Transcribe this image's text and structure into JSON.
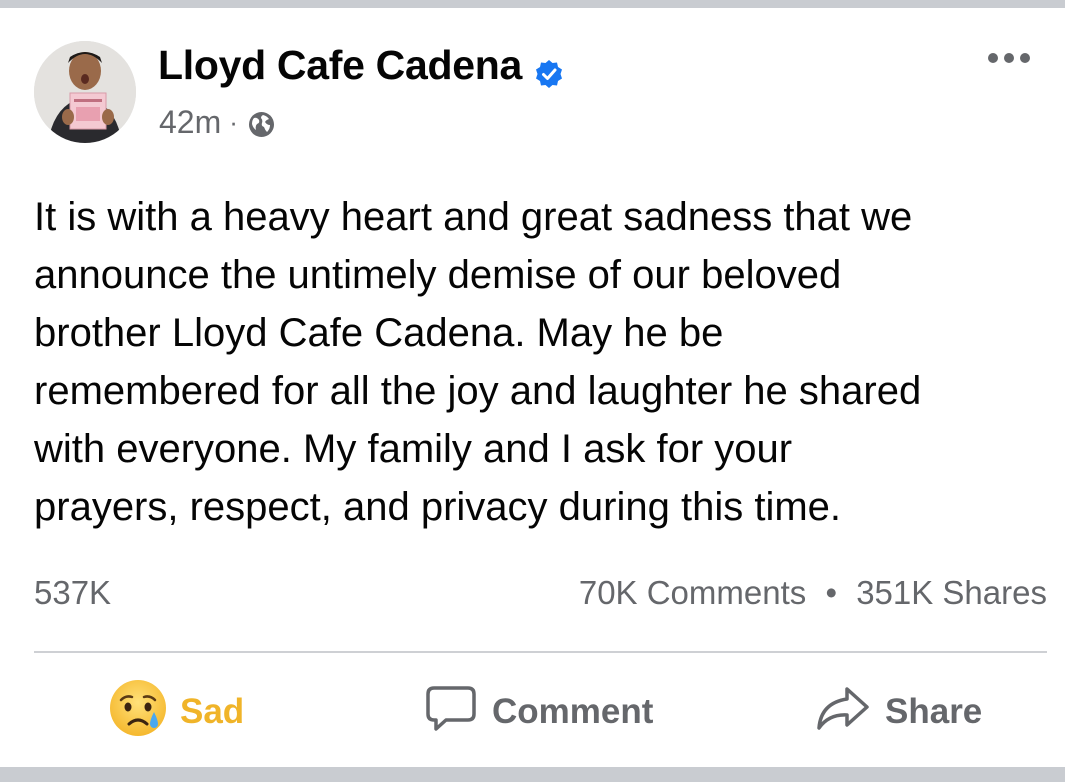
{
  "post": {
    "author": "Lloyd Cafe Cadena",
    "timestamp": "42m",
    "separator": "·",
    "privacy_icon": "globe-icon",
    "verified_icon": "verified-badge-icon",
    "verified_color": "#1877f2",
    "text_lines": [
      "It is with a heavy heart and great sadness that we",
      "announce the untimely demise of our beloved",
      "brother Lloyd Cafe Cadena. May he be",
      "remembered for all the joy and laughter he shared",
      "with everyone. My family and I ask for your",
      "prayers, respect, and privacy during this time."
    ]
  },
  "stats": {
    "reactions": "537K",
    "comments": "70K Comments",
    "separator": "•",
    "shares": "351K Shares"
  },
  "actions": {
    "reaction_label": "Sad",
    "reaction_icon": "sad-face-icon",
    "reaction_color": "#f0b429",
    "comment_label": "Comment",
    "share_label": "Share"
  },
  "colors": {
    "secondary_text": "#65676b",
    "divider": "#ced0d4",
    "frame_bar": "#c9ccd1"
  }
}
